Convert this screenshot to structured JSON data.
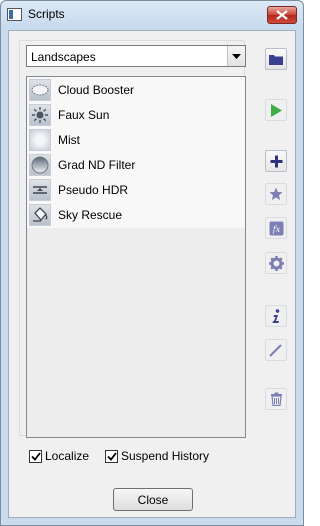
{
  "window": {
    "title": "Scripts"
  },
  "category": {
    "selected": "Landscapes"
  },
  "scripts": [
    {
      "label": "Cloud Booster",
      "icon": "cloud-icon"
    },
    {
      "label": "Faux Sun",
      "icon": "sun-icon"
    },
    {
      "label": "Mist",
      "icon": "mist-icon"
    },
    {
      "label": "Grad ND Filter",
      "icon": "gradient-filter-icon"
    },
    {
      "label": "Pseudo HDR",
      "icon": "hdr-icon"
    },
    {
      "label": "Sky Rescue",
      "icon": "paint-bucket-icon"
    }
  ],
  "options": {
    "localize_label": "Localize",
    "localize_checked": true,
    "suspend_label": "Suspend History",
    "suspend_checked": true
  },
  "footer": {
    "close_label": "Close"
  },
  "toolbar": [
    {
      "name": "folder-icon"
    },
    {
      "name": "play-icon"
    },
    {
      "name": "plus-icon"
    },
    {
      "name": "star-icon"
    },
    {
      "name": "fx-icon"
    },
    {
      "name": "gear-icon"
    },
    {
      "name": "info-icon"
    },
    {
      "name": "pencil-icon"
    },
    {
      "name": "trash-icon"
    }
  ],
  "colors": {
    "accent": "#3a3f8f",
    "play": "#3fae49",
    "disabled": "#7b7fb3"
  }
}
